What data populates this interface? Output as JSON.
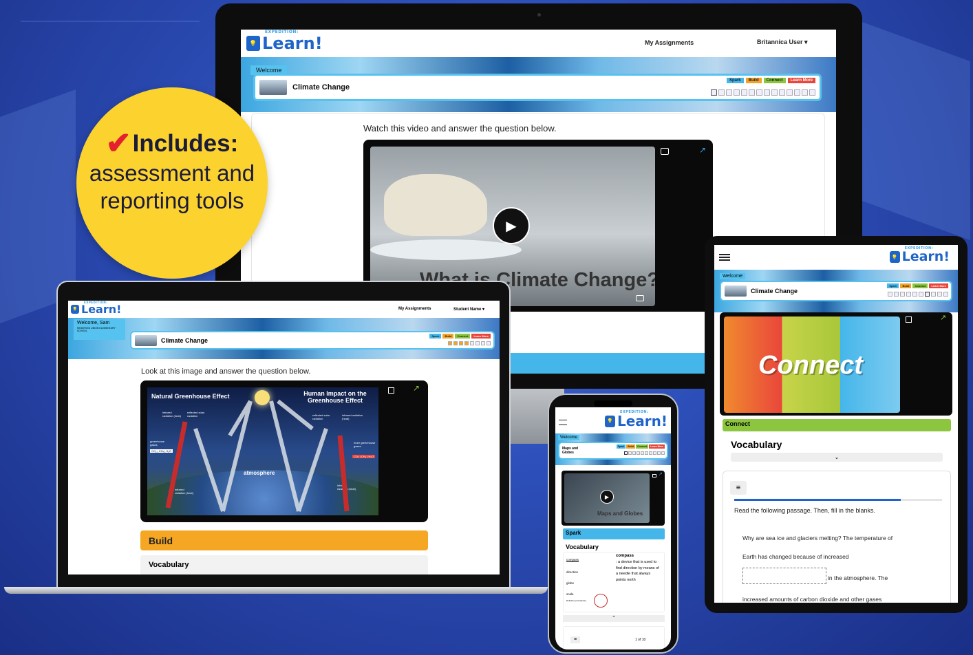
{
  "badge": {
    "check_icon": "checkmark-icon",
    "heading": "Includes:",
    "line1": "assessment and",
    "line2": "reporting tools"
  },
  "brand": {
    "logo_small": "EXPEDITION:",
    "logo_word": "Learn!"
  },
  "monitor": {
    "nav_assignments": "My Assignments",
    "nav_user": "Britannica User",
    "welcome": "Welcome",
    "topic": "Climate Change",
    "tags": [
      "Spark",
      "Build",
      "Connect",
      "Learn More"
    ],
    "instruction": "Watch this video and answer the question below.",
    "video_title": "What is Climate Change?"
  },
  "laptop": {
    "nav_assignments": "My Assignments",
    "nav_user": "Student Name",
    "welcome": "Welcome, Sam",
    "school": "RESERVED UNION ELEMENTARY SCHOOL",
    "topic": "Climate Change",
    "tags": [
      "Spark",
      "Build",
      "Connect",
      "Learn More"
    ],
    "instruction": "Look at this image and answer the question below.",
    "diagram": {
      "left_title": "Natural Greenhouse Effect",
      "right_title": "Human Impact on the Greenhouse Effect",
      "labels": {
        "infrared_left": "infrared radiation (heat)",
        "reflected_left": "reflected solar radiation",
        "reflected_right": "reflected solar radiation",
        "infrared_right": "infrared radiation (heat)",
        "gases_left": "greenhouse gases",
        "chem_left": "CO₂ | CH₄ | H₂O",
        "gases_right": "more greenhouse gases",
        "chem_right": "CO₂ | CH₄ | H₂O",
        "atmosphere": "atmosphere",
        "ir_bottom_left": "infrared radiation (heat)",
        "ir_bottom_right": "infrared radiation (heat)"
      }
    },
    "build_label": "Build",
    "vocab_label": "Vocabulary"
  },
  "phone": {
    "welcome": "Welcome",
    "topic": "Maps and Globes",
    "tags": [
      "Spark",
      "Build",
      "Connect",
      "Learn More"
    ],
    "video_title": "Maps and Globes",
    "section": "Spark",
    "vocab_heading": "Vocabulary",
    "terms": [
      "compass",
      "direction",
      "globe",
      "scale"
    ],
    "definition_term": "compass",
    "definition": ": a device that is used to find direction by means of a needle that always points north",
    "definition_credit": "Definition provided by",
    "pager": "1 of 10"
  },
  "tablet": {
    "welcome": "Welcome",
    "topic": "Climate Change",
    "tags": [
      "Spark",
      "Build",
      "Connect",
      "Learn More"
    ],
    "hero_text": "Connect",
    "section": "Connect",
    "vocab_heading": "Vocabulary",
    "instruction": "Read the following passage. Then, fill in the blanks.",
    "passage1": "Why are sea ice and glaciers melting? The temperature of",
    "passage2": "Earth has changed because of increased",
    "passage3": "in the atmosphere. The",
    "passage4": "increased amounts of carbon dioxide and other gases"
  },
  "colors": {
    "spark": "#45b6ea",
    "build": "#f3a428",
    "connect": "#8cc63f",
    "learn_more": "#e9463b",
    "badge": "#fcd22e"
  }
}
